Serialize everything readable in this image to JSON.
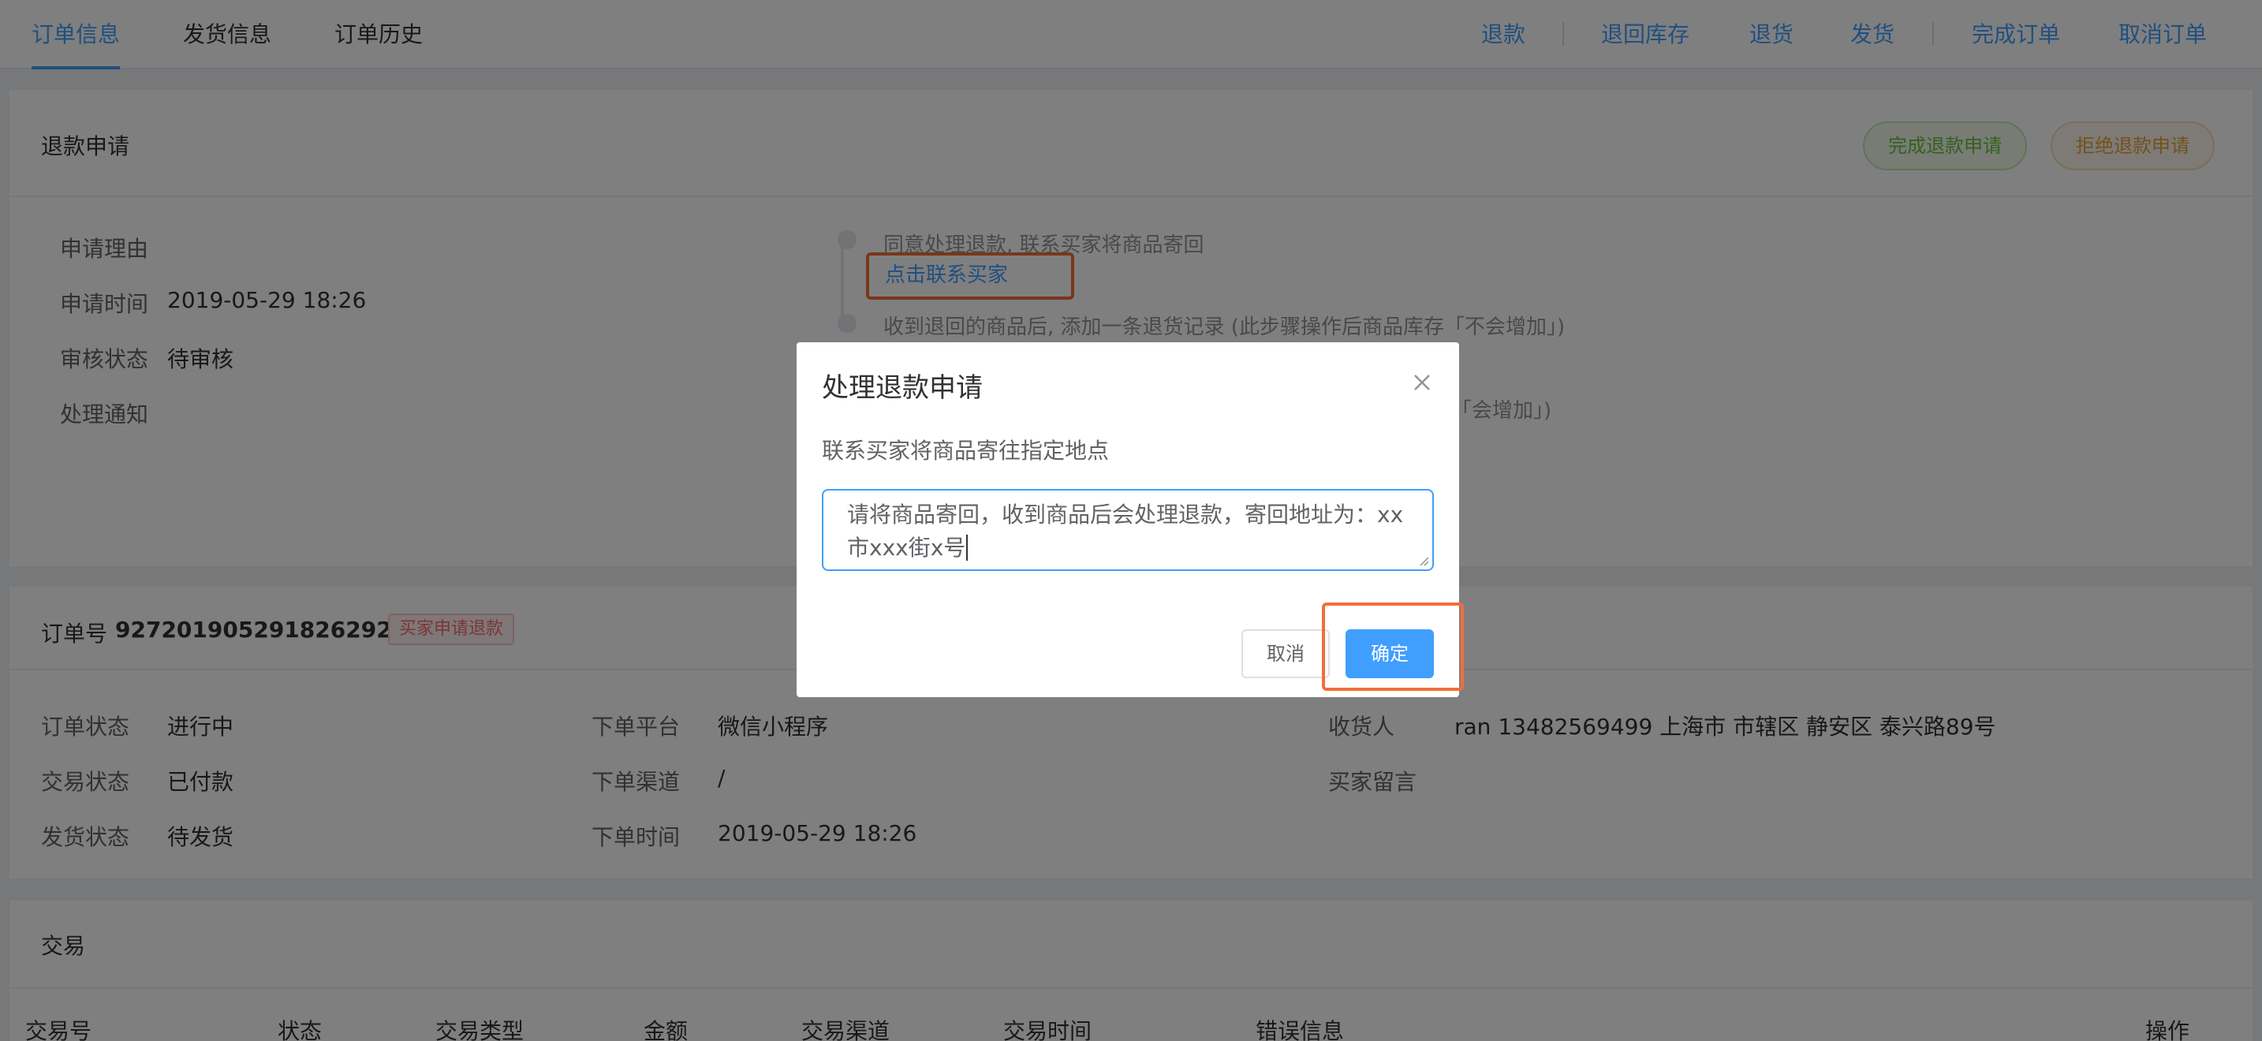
{
  "tabs": [
    {
      "label": "订单信息",
      "active": true
    },
    {
      "label": "发货信息",
      "active": false
    },
    {
      "label": "订单历史",
      "active": false
    }
  ],
  "actions": [
    "退款",
    "退回库存",
    "退货",
    "发货",
    "完成订单",
    "取消订单"
  ],
  "refund": {
    "title": "退款申请",
    "complete_btn": "完成退款申请",
    "reject_btn": "拒绝退款申请",
    "fields": {
      "reason_label": "申请理由",
      "time_label": "申请时间",
      "time_value": "2019-05-29 18:26",
      "status_label": "审核状态",
      "status_value": "待审核",
      "notice_label": "处理通知"
    },
    "timeline": {
      "step1": "同意处理退款, 联系买家将商品寄回",
      "step1_link": "点击联系买家",
      "step2": "收到退回的商品后, 添加一条退货记录 (此步骤操作后商品库存「不会增加」)",
      "step3_tail": "「会增加」)"
    }
  },
  "order": {
    "number_label": "订单号",
    "number_value": "92720190529182629254",
    "tag": "买家申请退款",
    "order_status_label": "订单状态",
    "order_status_value": "进行中",
    "trade_status_label": "交易状态",
    "trade_status_value": "已付款",
    "ship_status_label": "发货状态",
    "ship_status_value": "待发货",
    "platform_label": "下单平台",
    "platform_value": "微信小程序",
    "channel_label": "下单渠道",
    "channel_value": "/",
    "time_label": "下单时间",
    "time_value": "2019-05-29 18:26",
    "receiver_label": "收货人",
    "receiver_value": "ran 13482569499 上海市 市辖区 静安区 泰兴路89号",
    "buyer_msg_label": "买家留言"
  },
  "trade": {
    "title": "交易",
    "columns": [
      "交易号",
      "状态",
      "交易类型",
      "金额",
      "交易渠道",
      "交易时间",
      "错误信息",
      "操作"
    ]
  },
  "dialog": {
    "title": "处理退款申请",
    "message": "联系买家将商品寄往指定地点",
    "textarea_value": "请将商品寄回，收到商品后会处理退款，寄回地址为：xx市xxx街x号",
    "cancel": "取消",
    "confirm": "确定"
  },
  "colors": {
    "primary": "#409eff",
    "success": "#67c23a",
    "warning": "#e6a23c",
    "danger": "#f56c6c",
    "highlight": "#f56c3a"
  },
  "icons": {
    "close": "close-icon"
  }
}
